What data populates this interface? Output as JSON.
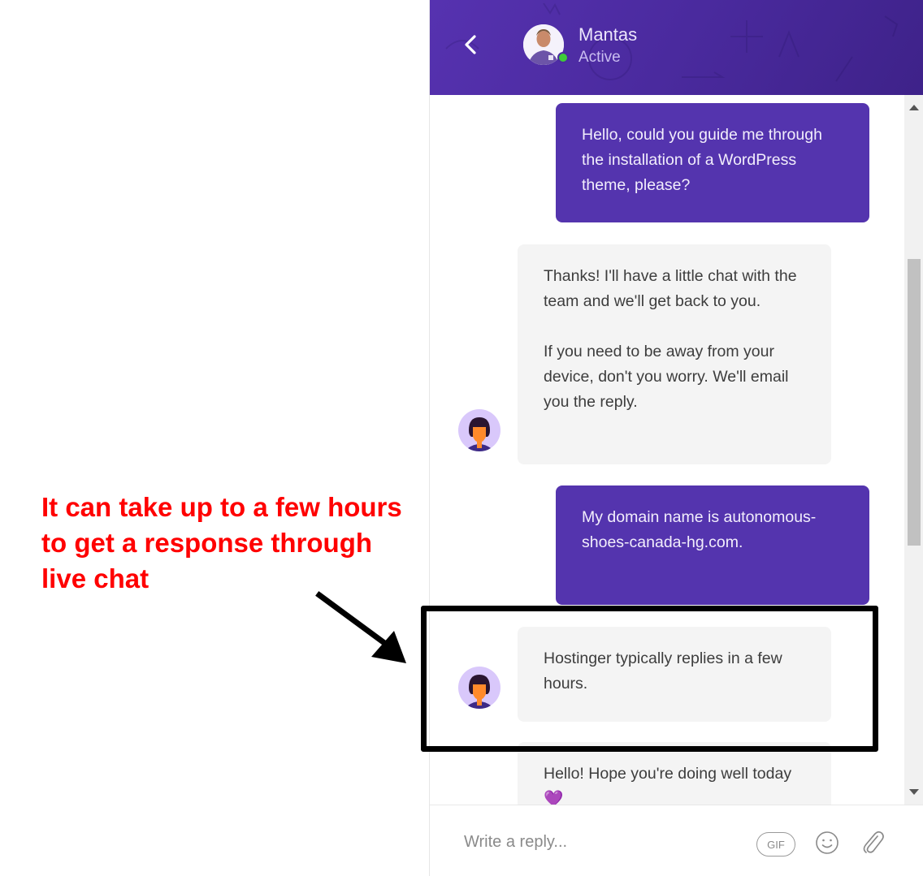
{
  "annotation": {
    "text": "It can take up to a few hours to get a response through live chat",
    "color": "#ff0000",
    "arrow_direction": "down-right",
    "highlight_target": "Hostinger typically replies in a few hours."
  },
  "header": {
    "back_icon": "chevron-left-icon",
    "agent_name": "Mantas",
    "agent_status": "Active",
    "status_color": "#3fcb3a",
    "background_color": "#4b2ba0"
  },
  "messages": [
    {
      "sender": "user",
      "text": "Hello, could you guide me through the installation of a WordPress theme, please?"
    },
    {
      "sender": "agent",
      "paragraphs": [
        "Thanks! I'll have a little chat with the team and we'll get back to you.",
        "If you need to be away from your device, don't you worry. We'll email you the reply."
      ]
    },
    {
      "sender": "user",
      "text": "My domain name is autonomous-shoes-canada-hg.com."
    },
    {
      "sender": "agent",
      "text": "Hostinger typically replies in a few hours."
    },
    {
      "sender": "agent",
      "text": "Hello! Hope you're doing well today 💜"
    }
  ],
  "colors": {
    "user_bubble": "#5434ae",
    "agent_bubble": "#f4f4f4"
  },
  "composer": {
    "placeholder": "Write a reply...",
    "gif_label": "GIF",
    "emoji_icon": "smiley-icon",
    "attach_icon": "paperclip-icon"
  }
}
